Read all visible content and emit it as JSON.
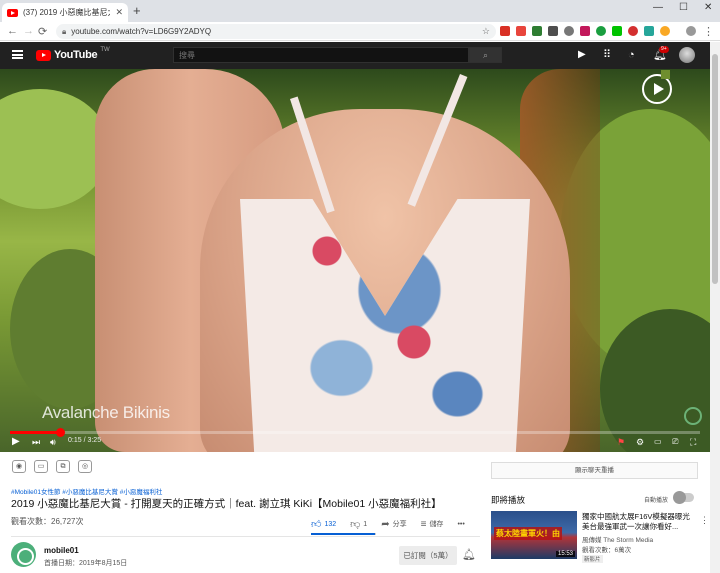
{
  "browser": {
    "tab_title": "(37) 2019 小惡魔比基尼大賞 - 打...",
    "tab_close": "✕",
    "new_tab": "+",
    "url": "youtube.com/watch?v=LD6G9Y2ADYQ",
    "window_controls": [
      "—",
      "☐",
      "✕"
    ]
  },
  "masthead": {
    "logo_text": "YouTube",
    "logo_region": "TW",
    "search_placeholder": "搜尋",
    "notification_count": "9+"
  },
  "player": {
    "watermark": "Avalanche Bikinis",
    "current_time": "0:15",
    "duration": "3:25",
    "time_display": "0:15 / 3:25",
    "progress_fraction": 0.073
  },
  "video_info": {
    "hashtags": "#Mobile01女性節 #小惡魔比基尼大賞 #小惡魔福利社",
    "title": "2019 小惡魔比基尼大賞 - 打開夏天的正確方式｜feat. 謝立琪 KiKi【Mobile01 小惡魔福利社】",
    "views": "觀看次數：26,727次",
    "likes": "132",
    "dislikes": "1",
    "share_label": "分享",
    "save_label": "儲存",
    "more_label": "•••",
    "like_ratio": 0.99
  },
  "channel": {
    "name": "mobile01",
    "published": "首播日期：2019年8月15日",
    "subscribe_label": "已訂閱（5萬）"
  },
  "sidebar": {
    "chat_button": "顯示聊天重播",
    "up_next_label": "即將播放",
    "autoplay_label": "自動播放",
    "recommendation": {
      "thumb_caption": "蔡太陸畫軍火！由",
      "duration": "15:53",
      "title": "獨家中國航太展F16V模擬器曝光 美台最強軍武一次讓你看好...",
      "channel": "風傳媒 The Storm Media",
      "views": "觀看次數：6萬次",
      "badge": "新影片"
    }
  },
  "colors": {
    "youtube_red": "#ff0000",
    "masthead_bg": "#212121",
    "link_blue": "#065fd4"
  }
}
